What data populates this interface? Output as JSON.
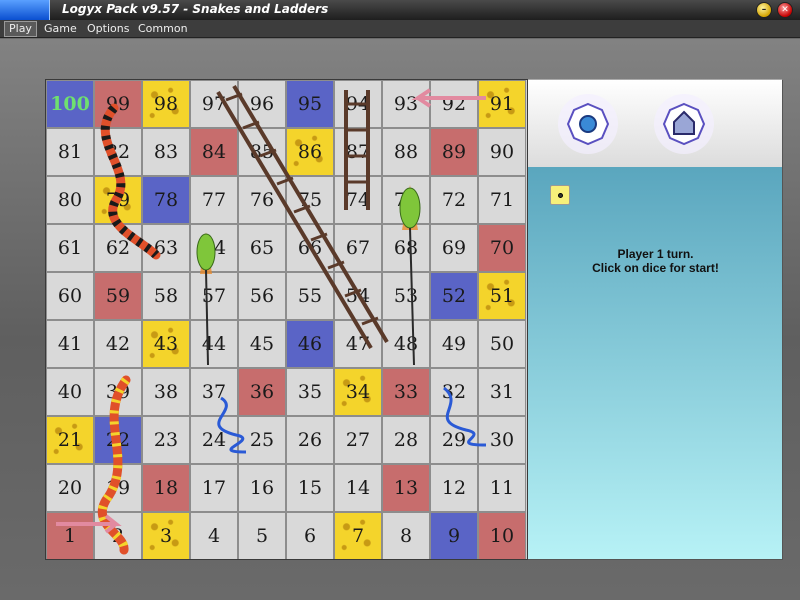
{
  "window": {
    "title": "Logyx Pack v9.57 - Snakes and Ladders"
  },
  "menu": [
    "Play",
    "Game",
    "Options",
    "Common"
  ],
  "board": {
    "rows": [
      [
        100,
        99,
        98,
        97,
        96,
        95,
        94,
        93,
        92,
        91
      ],
      [
        81,
        82,
        83,
        84,
        85,
        86,
        87,
        88,
        89,
        90
      ],
      [
        80,
        79,
        78,
        77,
        76,
        75,
        74,
        73,
        72,
        71
      ],
      [
        61,
        62,
        63,
        64,
        65,
        66,
        67,
        68,
        69,
        70
      ],
      [
        60,
        59,
        58,
        57,
        56,
        55,
        54,
        53,
        52,
        51
      ],
      [
        41,
        42,
        43,
        44,
        45,
        46,
        47,
        48,
        49,
        50
      ],
      [
        40,
        39,
        38,
        37,
        36,
        35,
        34,
        33,
        32,
        31
      ],
      [
        21,
        22,
        23,
        24,
        25,
        26,
        27,
        28,
        29,
        30
      ],
      [
        20,
        19,
        18,
        17,
        16,
        15,
        14,
        13,
        12,
        11
      ],
      [
        1,
        2,
        3,
        4,
        5,
        6,
        7,
        8,
        9,
        10
      ]
    ],
    "colors": {
      "100": "blue",
      "99": "red",
      "98": "yellow",
      "95": "blue",
      "91": "yellow",
      "84": "red",
      "86": "yellow",
      "89": "red",
      "79": "yellow",
      "78": "blue",
      "70": "red",
      "59": "red",
      "52": "blue",
      "51": "yellow",
      "43": "yellow",
      "46": "blue",
      "36": "red",
      "34": "yellow",
      "33": "red",
      "21": "yellow",
      "22": "blue",
      "18": "red",
      "13": "red",
      "1": "red",
      "3": "yellow",
      "7": "yellow",
      "9": "blue",
      "10": "red"
    }
  },
  "status": {
    "line1": "Player 1 turn.",
    "line2": "Click on dice for start!"
  },
  "dice": {
    "value": 1
  },
  "players": [
    "player-1-token",
    "player-2-token"
  ]
}
